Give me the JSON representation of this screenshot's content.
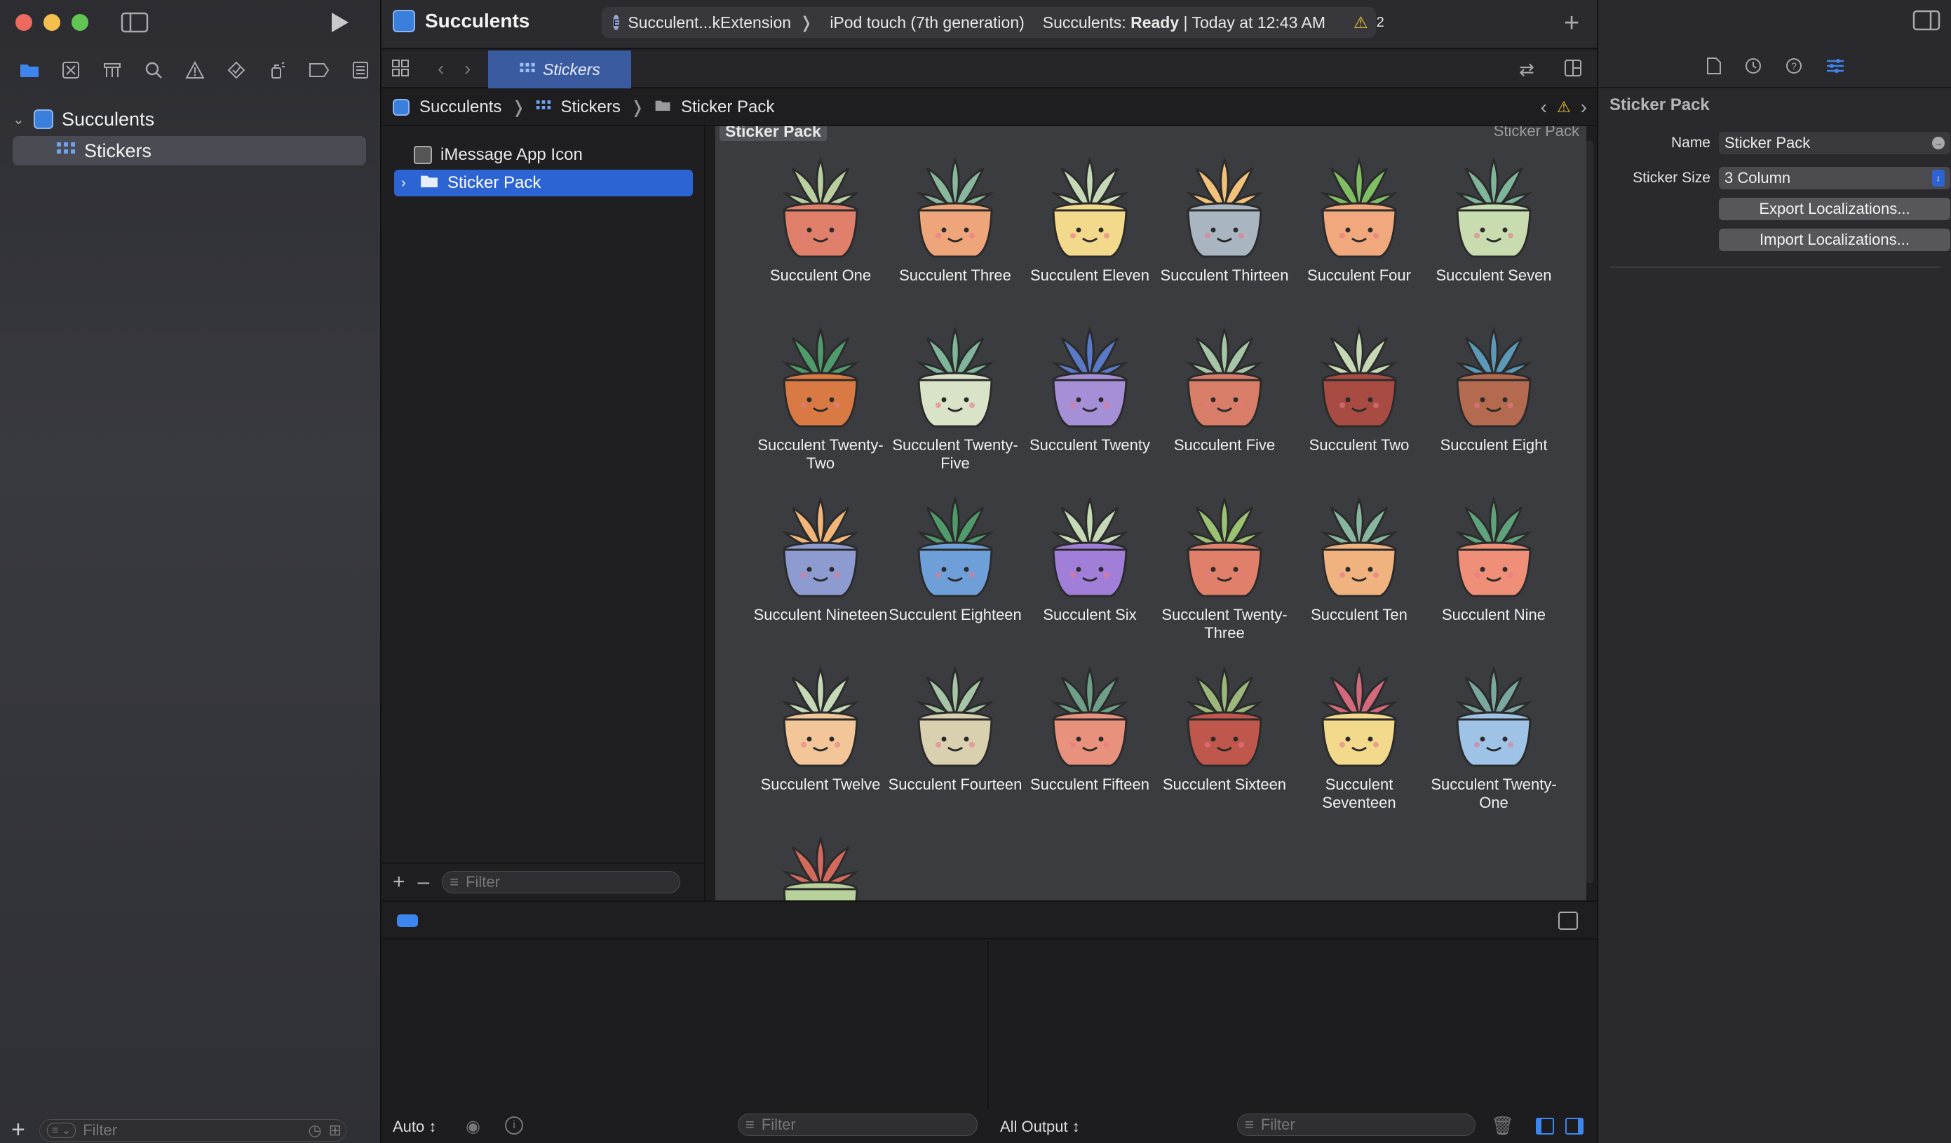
{
  "window": {
    "project_title": "Succulents",
    "scheme_target": "Succulent...kExtension",
    "device": "iPod touch (7th generation)",
    "status_prefix": "Succulents: ",
    "status_strong": "Ready",
    "status_suffix": " | Today at 12:43 AM",
    "warning_count": "2"
  },
  "navigator": {
    "root_item": "Succulents",
    "child_item": "Stickers",
    "filter_placeholder": "Filter"
  },
  "editor": {
    "active_tab": "Stickers",
    "breadcrumb": [
      "Succulents",
      "Stickers",
      "Sticker Pack"
    ],
    "outline_items": [
      "iMessage App Icon",
      "Sticker Pack"
    ],
    "outline_filter_placeholder": "Filter",
    "section_title": "Sticker Pack",
    "section_title_right": "Sticker Pack"
  },
  "stickers": [
    {
      "name": "Succulent One",
      "pot": "#e0806b",
      "leaf": "#b9cfa0"
    },
    {
      "name": "Succulent Three",
      "pot": "#efa57a",
      "leaf": "#88b79d"
    },
    {
      "name": "Succulent Eleven",
      "pot": "#f3d98c",
      "leaf": "#c5d9b6"
    },
    {
      "name": "Succulent Thirteen",
      "pot": "#a9b6c2",
      "leaf": "#f2c27a"
    },
    {
      "name": "Succulent Four",
      "pot": "#f0a87c",
      "leaf": "#7fbf62"
    },
    {
      "name": "Succulent Seven",
      "pot": "#c9dcb0",
      "leaf": "#7fb59b"
    },
    {
      "name": "Succulent Twenty-Two",
      "pot": "#d97a44",
      "leaf": "#4f9b6b"
    },
    {
      "name": "Succulent Twenty-Five",
      "pot": "#d9e3c8",
      "leaf": "#7fb59b"
    },
    {
      "name": "Succulent Twenty",
      "pot": "#a58fd6",
      "leaf": "#5a79c6"
    },
    {
      "name": "Succulent Five",
      "pot": "#d87d68",
      "leaf": "#a5c5a6"
    },
    {
      "name": "Succulent Two",
      "pot": "#a84b43",
      "leaf": "#c6d8b4"
    },
    {
      "name": "Succulent Eight",
      "pot": "#b36a4f",
      "leaf": "#5c98b8"
    },
    {
      "name": "Succulent Nineteen",
      "pot": "#8e9bd0",
      "leaf": "#f2b57a"
    },
    {
      "name": "Succulent Eighteen",
      "pot": "#6f9fd8",
      "leaf": "#4f9b6b"
    },
    {
      "name": "Succulent Six",
      "pot": "#a17fd8",
      "leaf": "#c5d9b6"
    },
    {
      "name": "Succulent Twenty-Three",
      "pot": "#e0806b",
      "leaf": "#9bc270"
    },
    {
      "name": "Succulent Ten",
      "pot": "#f0b27e",
      "leaf": "#88b7a0"
    },
    {
      "name": "Succulent Nine",
      "pot": "#ef8f78",
      "leaf": "#5fa37c"
    },
    {
      "name": "Succulent Twelve",
      "pot": "#f3c69a",
      "leaf": "#c5d9b6"
    },
    {
      "name": "Succulent Fourteen",
      "pot": "#d9d0b0",
      "leaf": "#a5c5a6"
    },
    {
      "name": "Succulent Fifteen",
      "pot": "#e8927d",
      "leaf": "#6f9f86"
    },
    {
      "name": "Succulent Sixteen",
      "pot": "#c0574c",
      "leaf": "#9bb87a"
    },
    {
      "name": "Succulent Seventeen",
      "pot": "#f3d98c",
      "leaf": "#d3697b"
    },
    {
      "name": "Succulent Twenty-One",
      "pot": "#9fc3e6",
      "leaf": "#7aa7a0"
    },
    {
      "name": "",
      "pot": "#b9d19a",
      "leaf": "#d46a5c"
    }
  ],
  "debug": {
    "auto_label": "Auto",
    "filter_placeholder": "Filter",
    "output_label": "All Output",
    "output_filter_placeholder": "Filter"
  },
  "inspector": {
    "title": "Sticker Pack",
    "name_label": "Name",
    "name_value": "Sticker Pack",
    "size_label": "Sticker Size",
    "size_value": "3 Column",
    "export_button": "Export Localizations...",
    "import_button": "Import Localizations..."
  },
  "colors": {
    "accent": "#2f6bd8",
    "selection": "#2d64d4",
    "warning": "#f2c233"
  }
}
